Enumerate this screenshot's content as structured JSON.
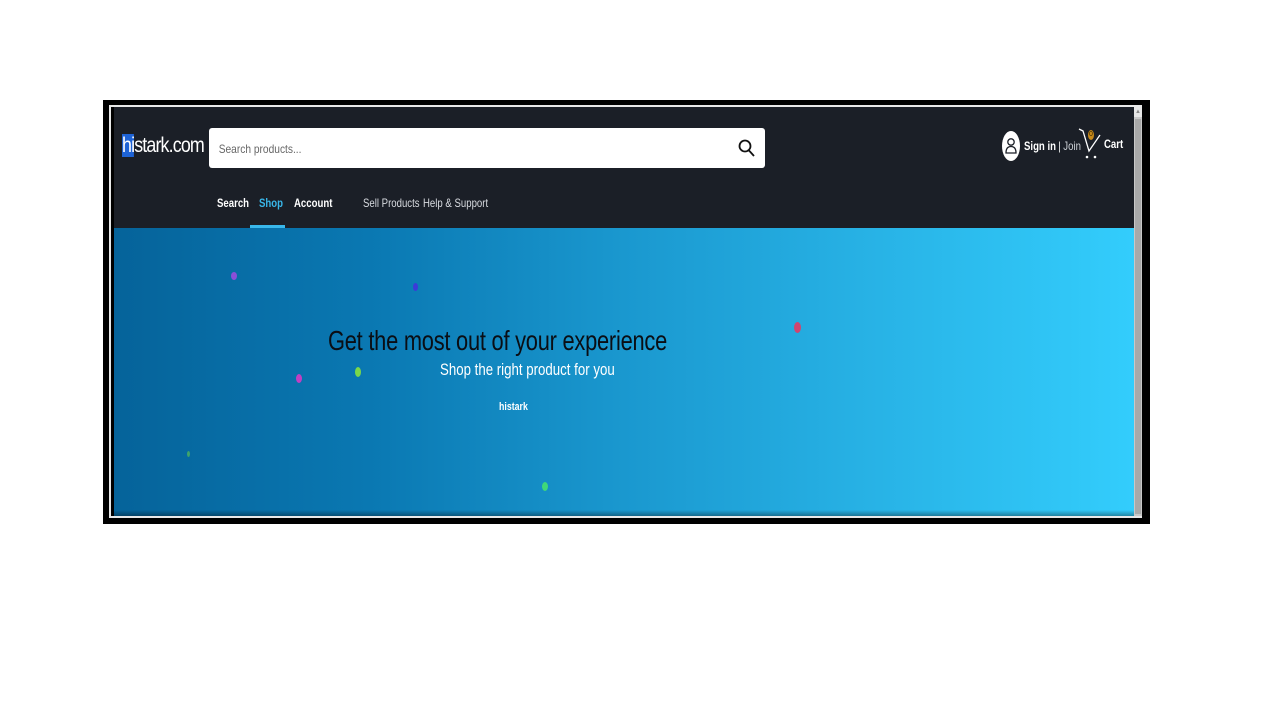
{
  "header": {
    "logo": {
      "highlight": "hi",
      "rest": "stark.com"
    },
    "search": {
      "placeholder": "Search products...",
      "value": ""
    },
    "account": {
      "sign_in": "Sign in",
      "separator": "|",
      "join": "Join"
    },
    "cart": {
      "label": "Cart",
      "count": "0"
    }
  },
  "nav": {
    "tabs": [
      {
        "label": "Search",
        "active": false
      },
      {
        "label": "Shop",
        "active": true
      },
      {
        "label": "Account",
        "active": false
      },
      {
        "label": "Sell Products",
        "active": false
      },
      {
        "label": "Help & Support",
        "active": false
      }
    ]
  },
  "hero": {
    "title": "Get the most out of your experience",
    "subtitle": "Shop the right product for you",
    "brand": "histark",
    "dot_colors": [
      "#8a4fd8",
      "#3b3bd8",
      "#d0456f",
      "#c23fc2",
      "#7ad84a",
      "#3fa36b",
      "#3fd87a"
    ]
  },
  "colors": {
    "header_bg": "#1b1f27",
    "accent": "#39b7ea",
    "logo_highlight": "#1e63d6",
    "hero_gradient_start": "#05639a",
    "hero_gradient_end": "#33cdfc"
  }
}
